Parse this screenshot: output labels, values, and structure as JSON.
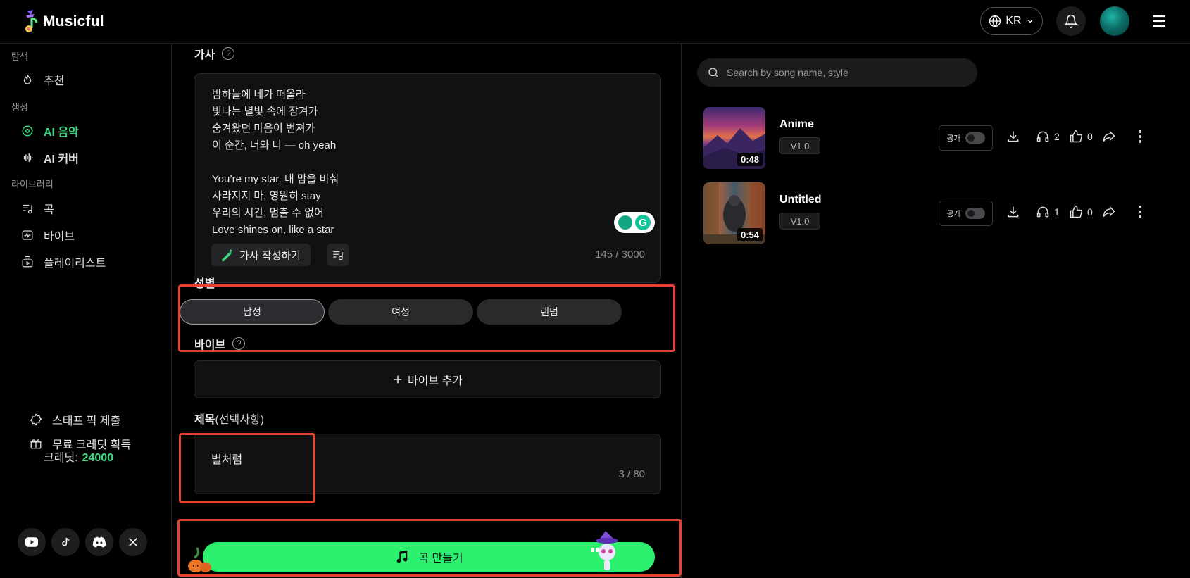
{
  "app": {
    "name": "Musicful"
  },
  "header": {
    "language": "KR"
  },
  "sidebar": {
    "sections": {
      "explore": "탐색",
      "create": "생성",
      "library": "라이브러리"
    },
    "items": {
      "recommend": "추천",
      "ai_music": "AI 음악",
      "ai_cover": "AI 커버",
      "songs": "곡",
      "vibe": "바이브",
      "playlist": "플레이리스트"
    },
    "staff_pick": "스태프 픽 제출",
    "free_credits": "무료 크레딧 획득",
    "credits_label": "크레딧:",
    "credits_value": "24000",
    "social": [
      "youtube-icon",
      "tiktok-icon",
      "discord-icon",
      "x-icon"
    ]
  },
  "form": {
    "lyrics_label": "가사",
    "lyrics_lines": [
      "밤하늘에 네가 떠올라",
      "빛나는 별빛 속에 잠겨가",
      "숨겨왔던 마음이 번져가",
      "이 순간, 너와 나 — oh yeah",
      "",
      "You’re my star, 내 맘을 비춰",
      "사라지지 마, 영원히 stay",
      "우리의 시간, 멈출 수 없어",
      "Love shines on, like a star"
    ],
    "write_lyrics_button": "가사 작성하기",
    "lyrics_counter": "145 / 3000",
    "gender_label": "성별",
    "gender_options": [
      "남성",
      "여성",
      "랜덤"
    ],
    "gender_selected": "남성",
    "vibe_label": "바이브",
    "vibe_add_button": "바이브 추가",
    "title_label": "제목",
    "title_optional": "(선택사항)",
    "title_value": "별처럼",
    "title_counter": "3 / 80",
    "create_button": "곡 만들기"
  },
  "right_panel": {
    "search_placeholder": "Search by song name, style",
    "songs": [
      {
        "title": "Anime",
        "version": "V1.0",
        "duration": "0:48",
        "public_label": "공개",
        "plays": "2",
        "likes": "0"
      },
      {
        "title": "Untitled",
        "version": "V1.0",
        "duration": "0:54",
        "public_label": "공개",
        "plays": "1",
        "likes": "0"
      }
    ]
  },
  "colors": {
    "accent": "#3ddc84",
    "create_button": "#2ef06f",
    "highlight": "#e5432f"
  }
}
